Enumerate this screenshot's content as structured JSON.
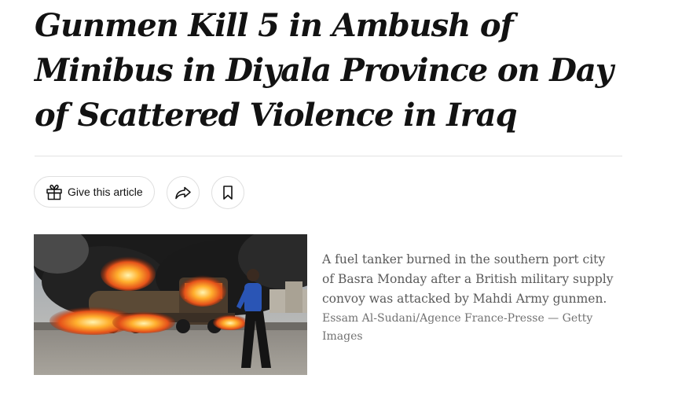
{
  "article": {
    "headline": "Gunmen Kill 5 in Ambush of Minibus in Diyala Province on Day of Scattered Violence in Iraq"
  },
  "actions": {
    "gift_label": "Give this article",
    "gift_icon": "gift-icon",
    "share_icon": "share-arrow-icon",
    "save_icon": "bookmark-icon"
  },
  "photo": {
    "caption": "A fuel tanker burned in the southern port city of Basra Monday after a British military supply convoy was attacked by Mahdi Army gunmen.",
    "credit": "Essam Al-Sudani/Agence France-Presse — Getty Images"
  },
  "colors": {
    "headline": "#121212",
    "caption": "#5a5a5a",
    "credit": "#727272",
    "divider": "#e2e2e2"
  }
}
